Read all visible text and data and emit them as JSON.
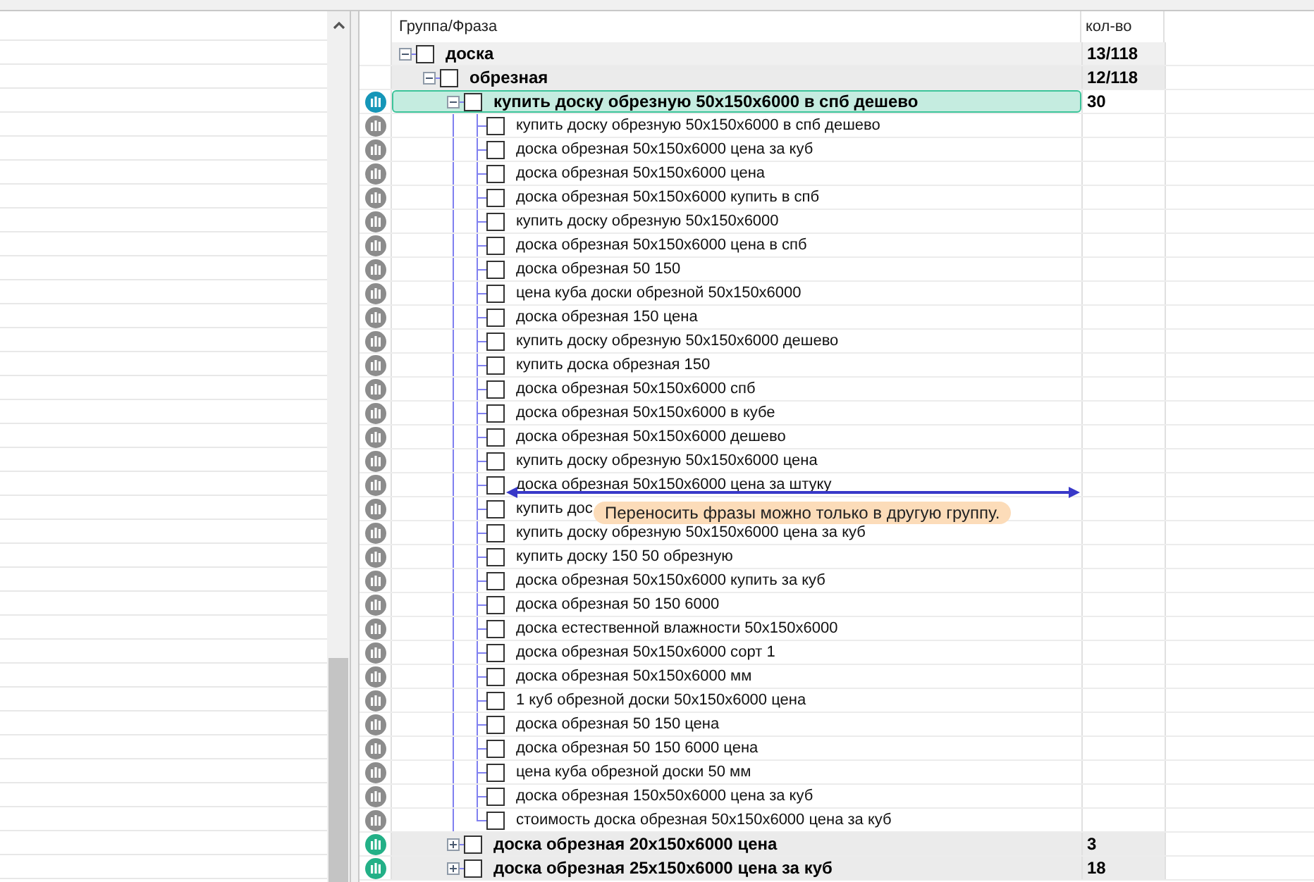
{
  "columns": [
    "Группа/Фраза",
    "кол-во"
  ],
  "tree": [
    {
      "kind": "group",
      "label": "доска",
      "count": "13/118",
      "expanded": true,
      "selected": false,
      "checked": false,
      "children": [
        {
          "kind": "group",
          "label": "обрезная",
          "count": "12/118",
          "expanded": true,
          "selected": false,
          "checked": false,
          "children": [
            {
              "kind": "group",
              "label": "купить доску обрезную 50x150x6000 в спб дешево",
              "count": "30",
              "expanded": true,
              "selected": true,
              "checked": false,
              "color": "#1596b8",
              "children": [
                {
                  "kind": "phrase",
                  "label": "купить доску обрезную 50x150x6000 в спб дешево",
                  "checked": false,
                  "color": "#8c8c8c"
                },
                {
                  "kind": "phrase",
                  "label": "доска обрезная 50x150x6000 цена за куб",
                  "checked": false,
                  "color": "#8c8c8c"
                },
                {
                  "kind": "phrase",
                  "label": "доска обрезная 50x150x6000 цена",
                  "checked": false,
                  "color": "#8c8c8c"
                },
                {
                  "kind": "phrase",
                  "label": "доска обрезная 50x150x6000 купить в спб",
                  "checked": false,
                  "color": "#8c8c8c"
                },
                {
                  "kind": "phrase",
                  "label": "купить доску обрезную 50x150x6000",
                  "checked": false,
                  "color": "#8c8c8c"
                },
                {
                  "kind": "phrase",
                  "label": "доска обрезная 50x150x6000 цена в спб",
                  "checked": false,
                  "color": "#8c8c8c"
                },
                {
                  "kind": "phrase",
                  "label": "доска обрезная 50 150",
                  "checked": false,
                  "color": "#8c8c8c"
                },
                {
                  "kind": "phrase",
                  "label": "цена куба доски обрезной 50x150x6000",
                  "checked": false,
                  "color": "#8c8c8c"
                },
                {
                  "kind": "phrase",
                  "label": "доска обрезная 150 цена",
                  "checked": false,
                  "color": "#8c8c8c"
                },
                {
                  "kind": "phrase",
                  "label": "купить доску обрезную 50x150x6000 дешево",
                  "checked": false,
                  "color": "#8c8c8c"
                },
                {
                  "kind": "phrase",
                  "label": "купить доска обрезная 150",
                  "checked": false,
                  "color": "#8c8c8c"
                },
                {
                  "kind": "phrase",
                  "label": "доска обрезная 50x150x6000 спб",
                  "checked": false,
                  "color": "#8c8c8c"
                },
                {
                  "kind": "phrase",
                  "label": "доска обрезная 50x150x6000 в кубе",
                  "checked": false,
                  "color": "#8c8c8c"
                },
                {
                  "kind": "phrase",
                  "label": "доска обрезная 50x150x6000 дешево",
                  "checked": false,
                  "color": "#8c8c8c"
                },
                {
                  "kind": "phrase",
                  "label": "купить доску обрезную 50x150x6000 цена",
                  "checked": false,
                  "color": "#8c8c8c"
                },
                {
                  "kind": "phrase",
                  "label": "доска обрезная 50x150x6000 цена за штуку",
                  "checked": false,
                  "color": "#8c8c8c"
                },
                {
                  "kind": "phrase",
                  "label": "купить дос",
                  "checked": false,
                  "color": "#8c8c8c"
                },
                {
                  "kind": "phrase",
                  "label": "купить доску обрезную 50x150x6000 цена за куб",
                  "checked": false,
                  "color": "#8c8c8c"
                },
                {
                  "kind": "phrase",
                  "label": "купить доску 150 50 обрезную",
                  "checked": false,
                  "color": "#8c8c8c"
                },
                {
                  "kind": "phrase",
                  "label": "доска обрезная 50x150x6000 купить за куб",
                  "checked": false,
                  "color": "#8c8c8c"
                },
                {
                  "kind": "phrase",
                  "label": "доска обрезная 50 150 6000",
                  "checked": false,
                  "color": "#8c8c8c"
                },
                {
                  "kind": "phrase",
                  "label": "доска естественной влажности 50x150x6000",
                  "checked": false,
                  "color": "#8c8c8c"
                },
                {
                  "kind": "phrase",
                  "label": "доска обрезная 50x150x6000 сорт 1",
                  "checked": false,
                  "color": "#8c8c8c"
                },
                {
                  "kind": "phrase",
                  "label": "доска обрезная 50x150x6000 мм",
                  "checked": false,
                  "color": "#8c8c8c"
                },
                {
                  "kind": "phrase",
                  "label": "1 куб обрезной доски 50x150x6000 цена",
                  "checked": false,
                  "color": "#8c8c8c"
                },
                {
                  "kind": "phrase",
                  "label": "доска обрезная 50 150 цена",
                  "checked": false,
                  "color": "#8c8c8c"
                },
                {
                  "kind": "phrase",
                  "label": "доска обрезная 50 150 6000 цена",
                  "checked": false,
                  "color": "#8c8c8c"
                },
                {
                  "kind": "phrase",
                  "label": "цена куба обрезной доски 50 мм",
                  "checked": false,
                  "color": "#8c8c8c"
                },
                {
                  "kind": "phrase",
                  "label": "доска обрезная 150x50x6000 цена за куб",
                  "checked": false,
                  "color": "#8c8c8c"
                },
                {
                  "kind": "phrase",
                  "label": "стоимость доска обрезная 50x150x6000 цена за куб",
                  "checked": false,
                  "color": "#8c8c8c"
                }
              ]
            },
            {
              "kind": "group",
              "label": "доска обрезная 20x150x6000 цена",
              "count": "3",
              "expanded": false,
              "selected": false,
              "checked": false,
              "color": "#23b087"
            },
            {
              "kind": "group",
              "label": "доска обрезная 25x150x6000 цена за куб",
              "count": "18",
              "expanded": false,
              "selected": false,
              "checked": false,
              "color": "#23b087"
            }
          ]
        }
      ]
    }
  ],
  "tooltip": "Переносить фразы можно только в другую группу."
}
